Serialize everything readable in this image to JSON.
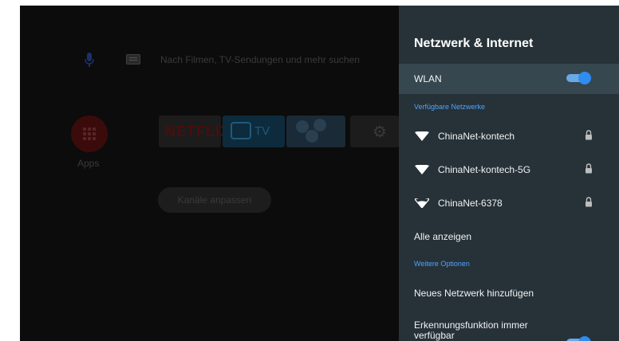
{
  "home": {
    "search_placeholder": "Nach Filmen, TV-Sendungen und mehr suchen",
    "apps_label": "Apps",
    "netflix_label": "NETFLIX",
    "tv_label": "TV",
    "channels_button": "Kanäle anpassen"
  },
  "panel": {
    "title": "Netzwerk & Internet",
    "wlan_label": "WLAN",
    "wlan_enabled": true,
    "available_section": "Verfügbare Netzwerke",
    "networks": [
      {
        "name": "ChinaNet-kontech",
        "secured": true
      },
      {
        "name": "ChinaNet-kontech-5G",
        "secured": true
      },
      {
        "name": "ChinaNet-6378",
        "secured": true
      }
    ],
    "show_all": "Alle anzeigen",
    "more_section": "Weitere Optionen",
    "add_network": "Neues Netzwerk hinzufügen",
    "scanning_label": "Erkennungsfunktion immer verfügbar",
    "scanning_enabled": true
  },
  "colors": {
    "panel_bg": "#263238",
    "highlight_bg": "#37474f",
    "accent": "#4fa3ff",
    "toggle_on": "#2f8cf0"
  },
  "icons": [
    "mic-icon",
    "keyboard-icon",
    "apps-grid-icon",
    "tv-icon",
    "settings-gear-icon",
    "wifi-icon",
    "lock-icon"
  ]
}
